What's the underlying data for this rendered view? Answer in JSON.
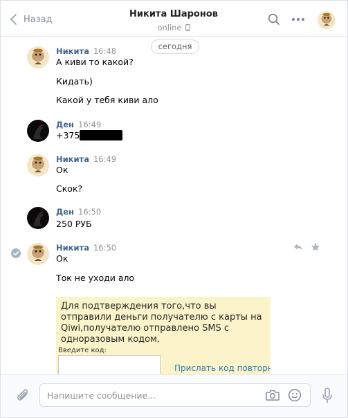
{
  "header": {
    "back_label": "Назад",
    "title": "Никита Шаронов",
    "status": "online"
  },
  "date_separator": "сегодня",
  "messages": [
    {
      "author": "Никита",
      "time": "16:48",
      "lines": [
        "А киви то какой?",
        "Кидать)",
        "Какой у тебя киви ало"
      ]
    },
    {
      "author": "Ден",
      "time": "16:49",
      "lines": [
        "+375"
      ]
    },
    {
      "author": "Никита",
      "time": "16:49",
      "lines": [
        "Ок",
        "Скок?"
      ]
    },
    {
      "author": "Ден",
      "time": "16:50",
      "lines": [
        "250 РУБ"
      ]
    },
    {
      "author": "Никита",
      "time": "16:50",
      "lines": [
        "Ок",
        "Ток не уходи ало"
      ]
    }
  ],
  "card": {
    "text": "Для подтверждения того,что вы отправили деньги получателю с карты на Qiwi,получателю отправлено SMS с одноразовым кодом.",
    "code_label": "Введите код:",
    "resend_label": "Прислать код повторно"
  },
  "composer": {
    "placeholder": "Напишите сообщение..."
  },
  "icons": {
    "back": "chevron-left-icon",
    "search": "search-icon",
    "more": "more-dots-icon",
    "phone": "mobile-phone-icon",
    "reply": "reply-icon",
    "star": "star-icon",
    "check": "check-icon",
    "attach": "paperclip-icon",
    "camera": "camera-icon",
    "smile": "smile-icon",
    "mic": "microphone-icon"
  },
  "colors": {
    "author": "#42648b",
    "muted": "#939393",
    "card_bg": "#fbf3c9",
    "link": "#2f7fb0"
  }
}
